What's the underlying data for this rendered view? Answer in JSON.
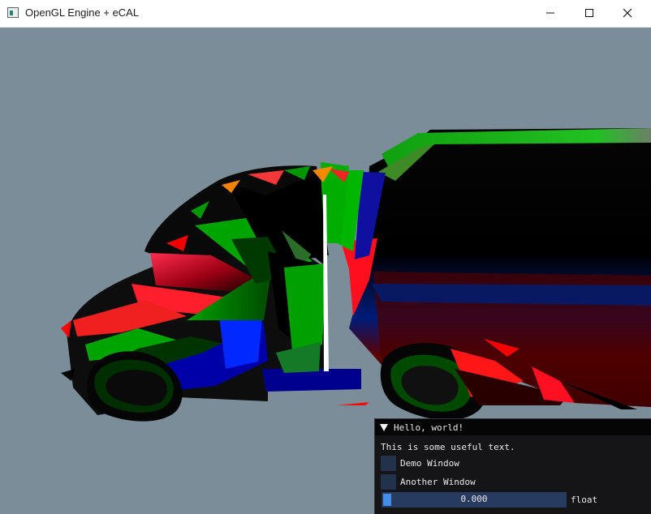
{
  "window": {
    "title": "OpenGL Engine + eCAL",
    "icons": {
      "app": "app-icon",
      "minimize": "minimize-icon",
      "maximize": "maximize-icon",
      "close": "close-icon"
    }
  },
  "scene": {
    "background_color": "#7b8d98",
    "object": "distorted-truck-model"
  },
  "imgui": {
    "title": "Hello, world!",
    "text": "This is some useful text.",
    "checkboxes": [
      {
        "label": "Demo Window",
        "checked": false
      },
      {
        "label": "Another Window",
        "checked": false
      }
    ],
    "slider": {
      "value": "0.000",
      "label": "float"
    },
    "colors": {
      "window_bg": "#151517",
      "title_bg": "#050505",
      "frame_bg": "#263b5f",
      "slider_grab": "#438fe8"
    }
  }
}
